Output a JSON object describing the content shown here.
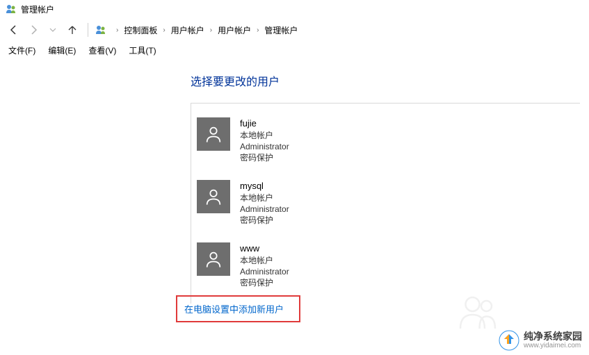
{
  "window": {
    "title": "管理帐户"
  },
  "breadcrumb": {
    "items": [
      "控制面板",
      "用户帐户",
      "用户帐户",
      "管理帐户"
    ]
  },
  "menu": {
    "file": "文件(F)",
    "edit": "编辑(E)",
    "view": "查看(V)",
    "tools": "工具(T)"
  },
  "heading": "选择要更改的用户",
  "accounts": [
    {
      "name": "fujie",
      "type": "本地帐户",
      "role": "Administrator",
      "pw": "密码保护"
    },
    {
      "name": "mysql",
      "type": "本地帐户",
      "role": "Administrator",
      "pw": "密码保护"
    },
    {
      "name": "www",
      "type": "本地帐户",
      "role": "Administrator",
      "pw": "密码保护"
    }
  ],
  "add_user_link": "在电脑设置中添加新用户",
  "watermark": {
    "title": "纯净系统家园",
    "url": "www.yidaimei.com"
  }
}
